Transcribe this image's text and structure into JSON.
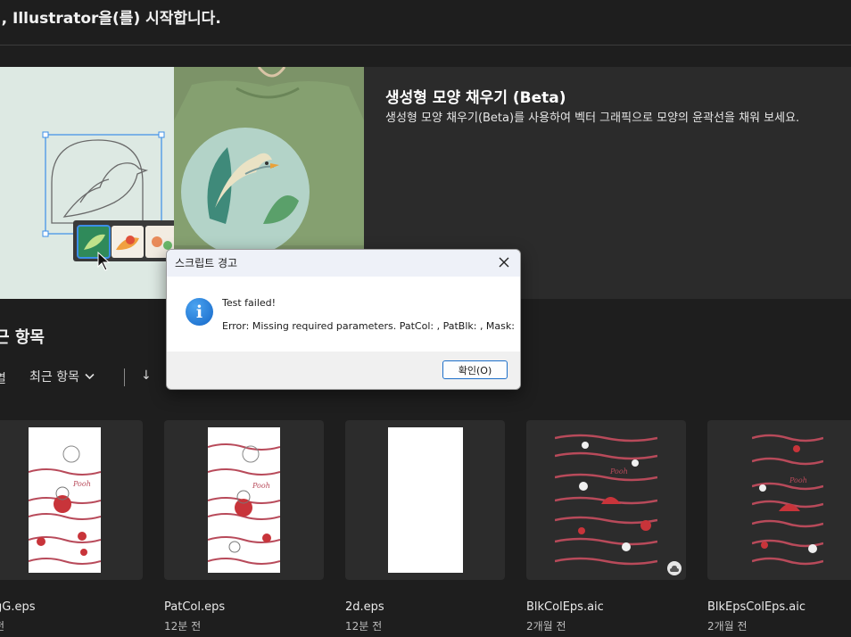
{
  "header": {
    "greeting": "님, Illustrator을(를) 시작합니다."
  },
  "banner": {
    "title": "생성형 모양 채우기 (Beta)",
    "description": "생성형 모양 채우기(Beta)를 사용하여 벡터 그래픽으로 모양의 윤곽선을 채워 보세요."
  },
  "recent": {
    "title": "근 항목",
    "sort_label": "열",
    "filter_label": "최근 항목",
    "sort_arrow": "↓"
  },
  "files": [
    {
      "name": "gG.eps",
      "time": "전",
      "cloud": false
    },
    {
      "name": "PatCol.eps",
      "time": "12분 전",
      "cloud": false
    },
    {
      "name": "2d.eps",
      "time": "12분 전",
      "cloud": false
    },
    {
      "name": "BlkColEps.aic",
      "time": "2개월 전",
      "cloud": true
    },
    {
      "name": "BlkEpsColEps.aic",
      "time": "2개월 전",
      "cloud": true
    }
  ],
  "dialog": {
    "title": "스크립트 경고",
    "line1": "Test failed!",
    "line2": "Error: Missing required parameters. PatCol: , PatBlk: , Mask:",
    "ok_label": "확인(O)",
    "icon": "info-icon"
  },
  "colors": {
    "background": "#1e1e1e",
    "banner_bg": "#2b2b2b",
    "card_bg": "#2c2c2c",
    "dialog_accent": "#1d6fc9",
    "pattern_red": "#b84a5a"
  }
}
